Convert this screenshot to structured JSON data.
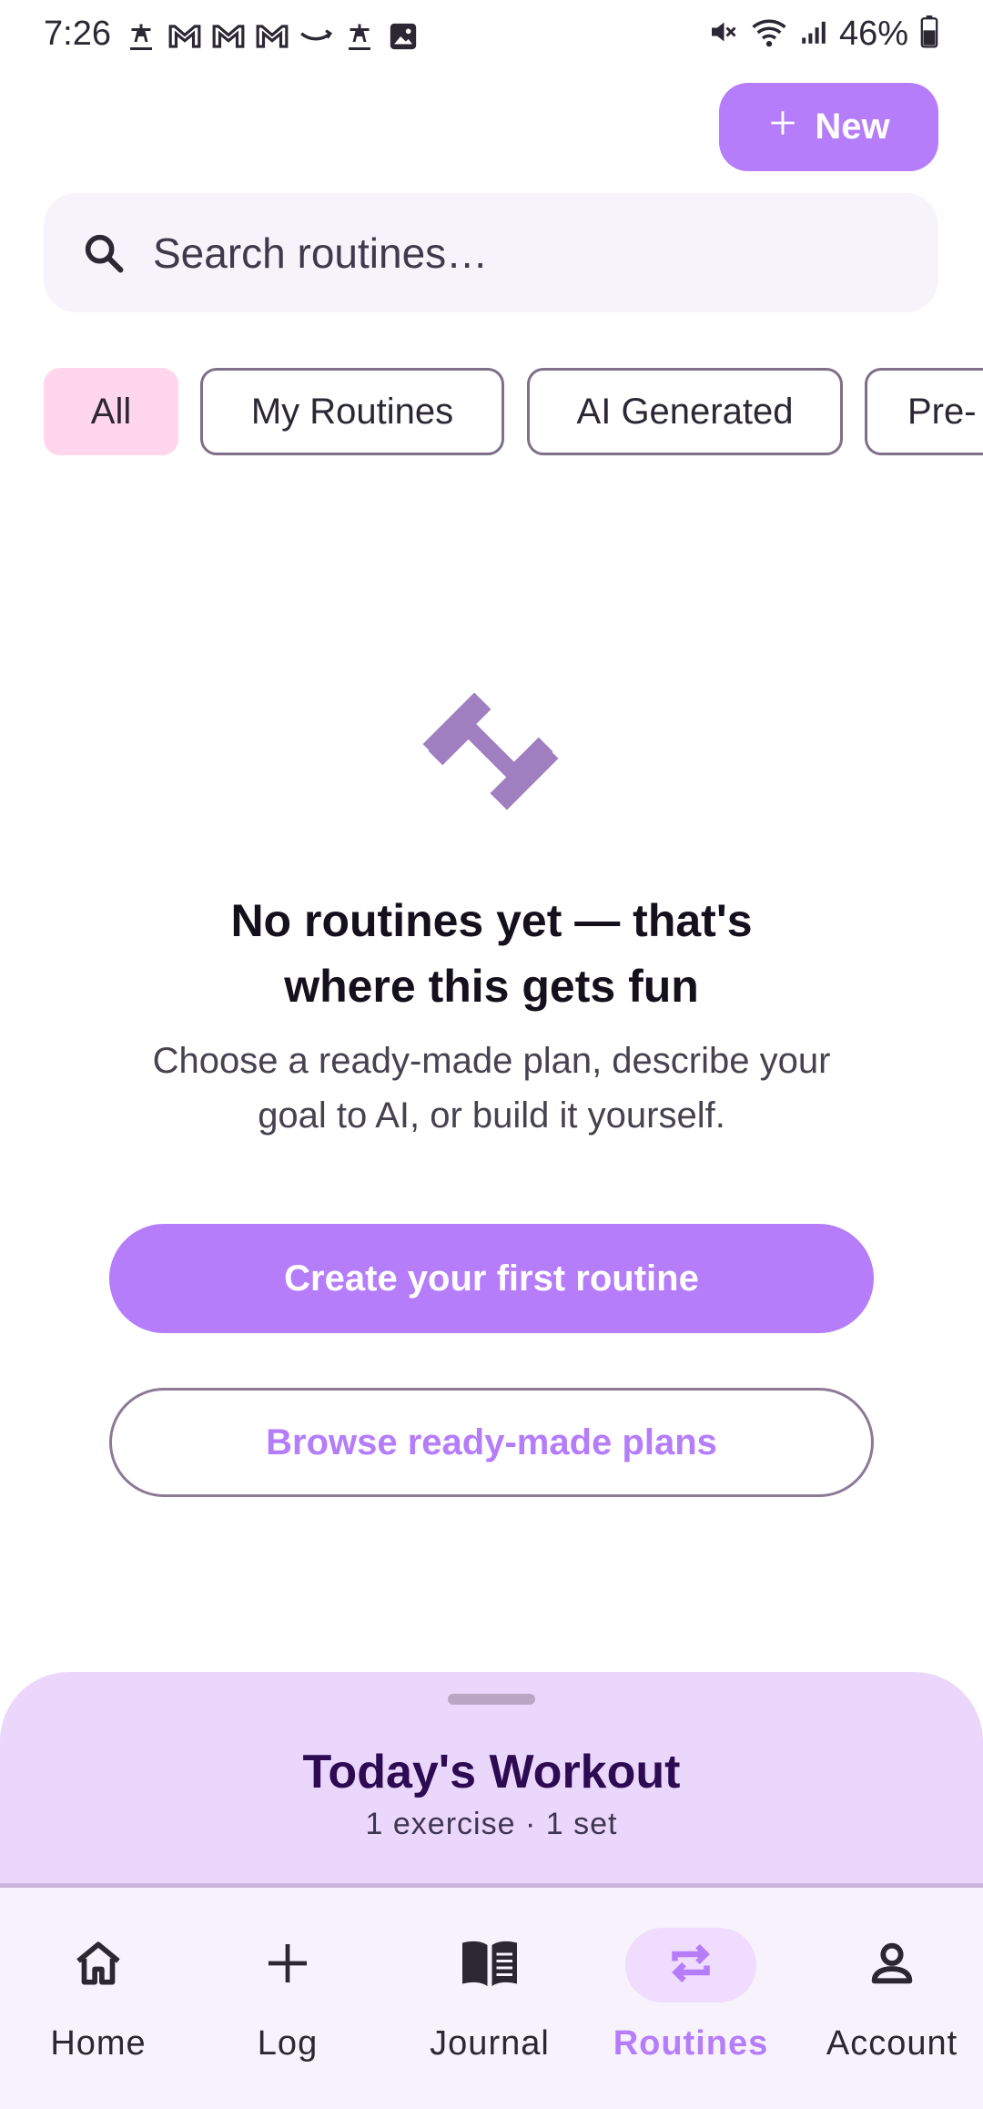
{
  "status_bar": {
    "time": "7:26",
    "battery": "46%",
    "notification_icons": [
      "app-icon",
      "gmail-icon",
      "gmail-icon",
      "gmail-icon",
      "amazon-icon",
      "app-icon",
      "gallery-icon"
    ],
    "system_icons": [
      "mute-icon",
      "wifi-icon",
      "signal-icon",
      "battery-icon"
    ]
  },
  "header": {
    "new_button_label": "New"
  },
  "search": {
    "placeholder": "Search routines…"
  },
  "filters": {
    "chips": [
      {
        "label": "All",
        "selected": true
      },
      {
        "label": "My Routines",
        "selected": false
      },
      {
        "label": "AI Generated",
        "selected": false
      },
      {
        "label": "Pre-",
        "selected": false
      }
    ]
  },
  "empty_state": {
    "icon": "barbell-icon",
    "title_line1": "No routines yet — that's",
    "title_line2": "where this gets fun",
    "subtitle_line1": "Choose a ready-made plan, describe your",
    "subtitle_line2": "goal to AI, or build it yourself.",
    "primary_action": "Create your first routine",
    "secondary_action": "Browse ready-made plans"
  },
  "workout_sheet": {
    "title": "Today's Workout",
    "summary": "1 exercise · 1 set"
  },
  "bottom_nav": {
    "items": [
      {
        "label": "Home",
        "icon": "home-icon",
        "active": false
      },
      {
        "label": "Log",
        "icon": "plus-icon",
        "active": false
      },
      {
        "label": "Journal",
        "icon": "book-icon",
        "active": false
      },
      {
        "label": "Routines",
        "icon": "repeat-icon",
        "active": true
      },
      {
        "label": "Account",
        "icon": "person-icon",
        "active": false
      }
    ]
  },
  "colors": {
    "accent": "#b57df9",
    "chip_selected": "#ffd6ec",
    "sheet_bg": "#ecd7fc",
    "nav_bg": "#f7f2fc",
    "icon_muted": "#a07fc0"
  }
}
